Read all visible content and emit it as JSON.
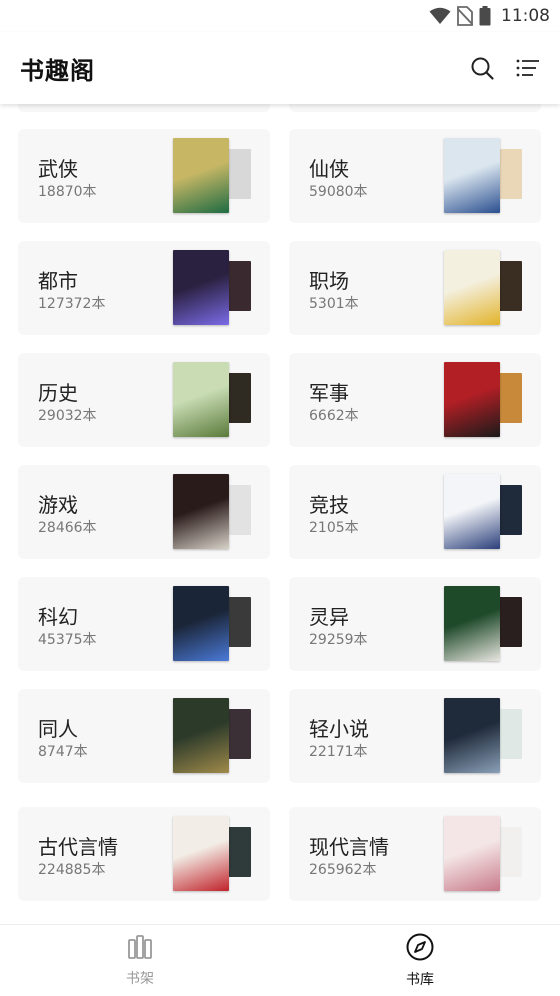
{
  "status_bar": {
    "time": "11:08"
  },
  "app_bar": {
    "title": "书趣阁"
  },
  "categories": [
    {
      "name": "武侠",
      "count": "18870本",
      "front_bg": "#c7b765",
      "front_accent": "#1e6b43",
      "back_bg": "#d8d8d8"
    },
    {
      "name": "仙侠",
      "count": "59080本",
      "front_bg": "#dbe6ef",
      "front_accent": "#2a4f8f",
      "back_bg": "#e9d7b7"
    },
    {
      "name": "都市",
      "count": "127372本",
      "front_bg": "#2a2140",
      "front_accent": "#7b6be8",
      "back_bg": "#3a2a30"
    },
    {
      "name": "职场",
      "count": "5301本",
      "front_bg": "#f4f0e0",
      "front_accent": "#e2b32a",
      "back_bg": "#3a2e22"
    },
    {
      "name": "历史",
      "count": "29032本",
      "front_bg": "#c9dcb4",
      "front_accent": "#5a7a3a",
      "back_bg": "#2f2a22"
    },
    {
      "name": "军事",
      "count": "6662本",
      "front_bg": "#b21f25",
      "front_accent": "#1a1a1a",
      "back_bg": "#c88a3a"
    },
    {
      "name": "游戏",
      "count": "28466本",
      "front_bg": "#2a1b1b",
      "front_accent": "#d8d2c8",
      "back_bg": "#e2e2e2"
    },
    {
      "name": "竞技",
      "count": "2105本",
      "front_bg": "#f3f5f8",
      "front_accent": "#2a3e7a",
      "back_bg": "#1f2a3a"
    },
    {
      "name": "科幻",
      "count": "45375本",
      "front_bg": "#1b2538",
      "front_accent": "#4a7ad8",
      "back_bg": "#3a3a3a"
    },
    {
      "name": "灵异",
      "count": "29259本",
      "front_bg": "#1f4a2a",
      "front_accent": "#e8e6e0",
      "back_bg": "#2a1f1f"
    },
    {
      "name": "同人",
      "count": "8747本",
      "front_bg": "#2c3a2a",
      "front_accent": "#a08a4a",
      "back_bg": "#3a3036"
    },
    {
      "name": "轻小说",
      "count": "22171本",
      "front_bg": "#1f2a3a",
      "front_accent": "#8aa0b8",
      "back_bg": "#dfe8e4"
    },
    {
      "name": "古代言情",
      "count": "224885本",
      "front_bg": "#f2ede6",
      "front_accent": "#c0222a",
      "back_bg": "#2f3a3a"
    },
    {
      "name": "现代言情",
      "count": "265962本",
      "front_bg": "#f4e6e6",
      "front_accent": "#c87a8a",
      "back_bg": "#f2f0ef"
    }
  ],
  "nav": {
    "shelf_label": "书架",
    "library_label": "书库"
  }
}
